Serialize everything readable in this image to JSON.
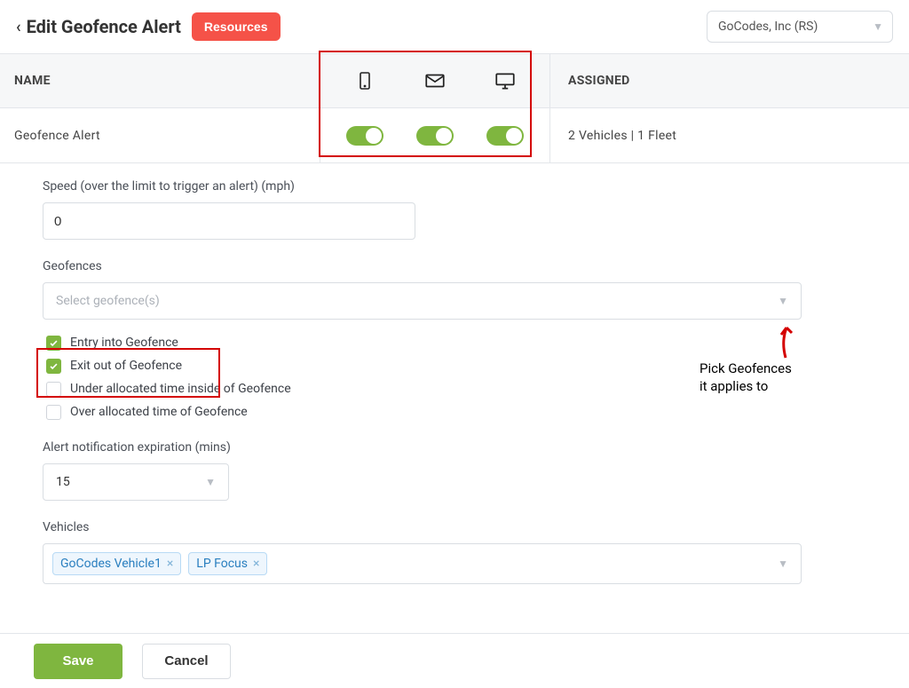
{
  "header": {
    "title": "Edit Geofence Alert",
    "resources_btn": "Resources",
    "org_selected": "GoCodes, Inc (RS)"
  },
  "columns": {
    "name": "NAME",
    "assigned": "ASSIGNED"
  },
  "row": {
    "name": "Geofence Alert",
    "assigned": "2 Vehicles | 1 Fleet",
    "toggles": {
      "mobile": true,
      "email": true,
      "desktop": true
    }
  },
  "form": {
    "speed_label": "Speed (over the limit to trigger an alert) (mph)",
    "speed_value": "0",
    "geofences_label": "Geofences",
    "geofences_placeholder": "Select geofence(s)",
    "checks": {
      "entry": "Entry into Geofence",
      "exit": "Exit out of Geofence",
      "under": "Under allocated time inside of Geofence",
      "over": "Over allocated time of Geofence",
      "entry_checked": true,
      "exit_checked": true,
      "under_checked": false,
      "over_checked": false
    },
    "expiry_label": "Alert notification expiration (mins)",
    "expiry_value": "15",
    "vehicles_label": "Vehicles",
    "vehicles": [
      "GoCodes Vehicle1",
      "LP Focus"
    ]
  },
  "footer": {
    "save": "Save",
    "cancel": "Cancel"
  },
  "annotation": {
    "line1": "Pick Geofences",
    "line2": "it applies to"
  }
}
